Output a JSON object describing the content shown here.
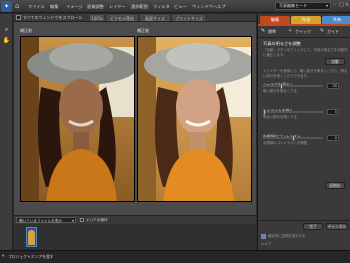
{
  "menubar": {
    "items": [
      "ファイル",
      "編集",
      "イメージ",
      "画質調整",
      "レイヤー",
      "選択範囲",
      "フィルタ",
      "ビュー",
      "ウィンドウ",
      "ヘルプ"
    ],
    "mode_button": "写真編集モード",
    "window_controls": [
      "–",
      "□",
      "×"
    ]
  },
  "options_bar": {
    "checkbox_label": "すべてのウィンドウをスクロール",
    "buttons": [
      "100%",
      "ピクセル等倍",
      "画面サイズ",
      "プリントサイズ"
    ]
  },
  "canvas": {
    "before_label": "補正前",
    "after_label": "補正後"
  },
  "bin": {
    "dropdown": "開いているファイルを表示",
    "checkbox_label": "エリアの操作"
  },
  "status": {
    "text": "プロジェクトエリアを隠す"
  },
  "panel": {
    "tabs": [
      "編集",
      "作成",
      "共有"
    ],
    "tab_colors": [
      "#c2491f",
      "#d9a12a",
      "#4a8bd0"
    ],
    "subtabs": [
      "標準",
      "クイック",
      "ガイド"
    ],
    "title": "写真の明るさを調整",
    "intro": "「自動」ボタンをクリックして、写真の明るさを自動的に補正します。",
    "auto_button": "自動",
    "desc": "スライダーを使用して、暗い部分を明るくしたり、明るい部分を暗くしたりできます。",
    "sliders": [
      {
        "label": "シャドウを明るく",
        "hint": "暗い部分を明るくする",
        "value": "30",
        "level": 0.3
      },
      {
        "label": "ハイライトを暗く",
        "hint": "明るい部分を暗くする",
        "value": "0",
        "level": 0.0
      },
      {
        "label": "中間調のコントラスト",
        "hint": "中間調のコントラストを調整",
        "value": "0",
        "level": 0.5
      }
    ],
    "reset_button": "初期化",
    "done_button": "完了",
    "cancel_button": "キャンセル",
    "tips_checkbox": "補足的に説明を表示する",
    "help_link": "ヘルプ"
  }
}
